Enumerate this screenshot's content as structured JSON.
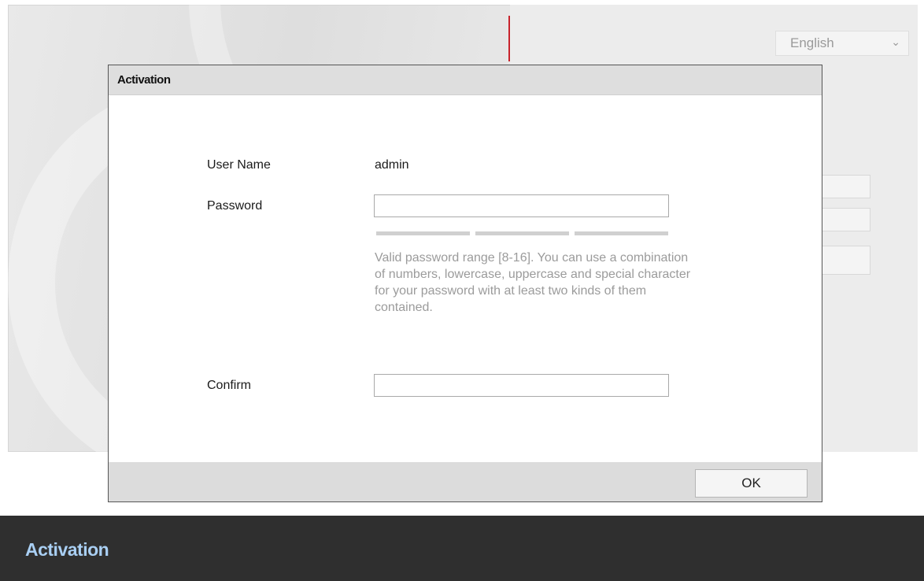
{
  "background": {
    "language": "English"
  },
  "dialog": {
    "title": "Activation",
    "username_label": "User Name",
    "username_value": "admin",
    "password_label": "Password",
    "password_value": "",
    "password_hint": "Valid password range [8-16]. You can use a combination of numbers, lowercase, uppercase and special character for your password with at least two kinds of them contained.",
    "confirm_label": "Confirm",
    "confirm_value": "",
    "ok_label": "OK"
  },
  "caption": {
    "title": "Activation"
  },
  "colors": {
    "accent_red": "#c8222b",
    "caption_text": "#a9cff3",
    "caption_background": "#2f2f2f"
  },
  "icons": {
    "language_dropdown": "chevron-down-icon"
  }
}
